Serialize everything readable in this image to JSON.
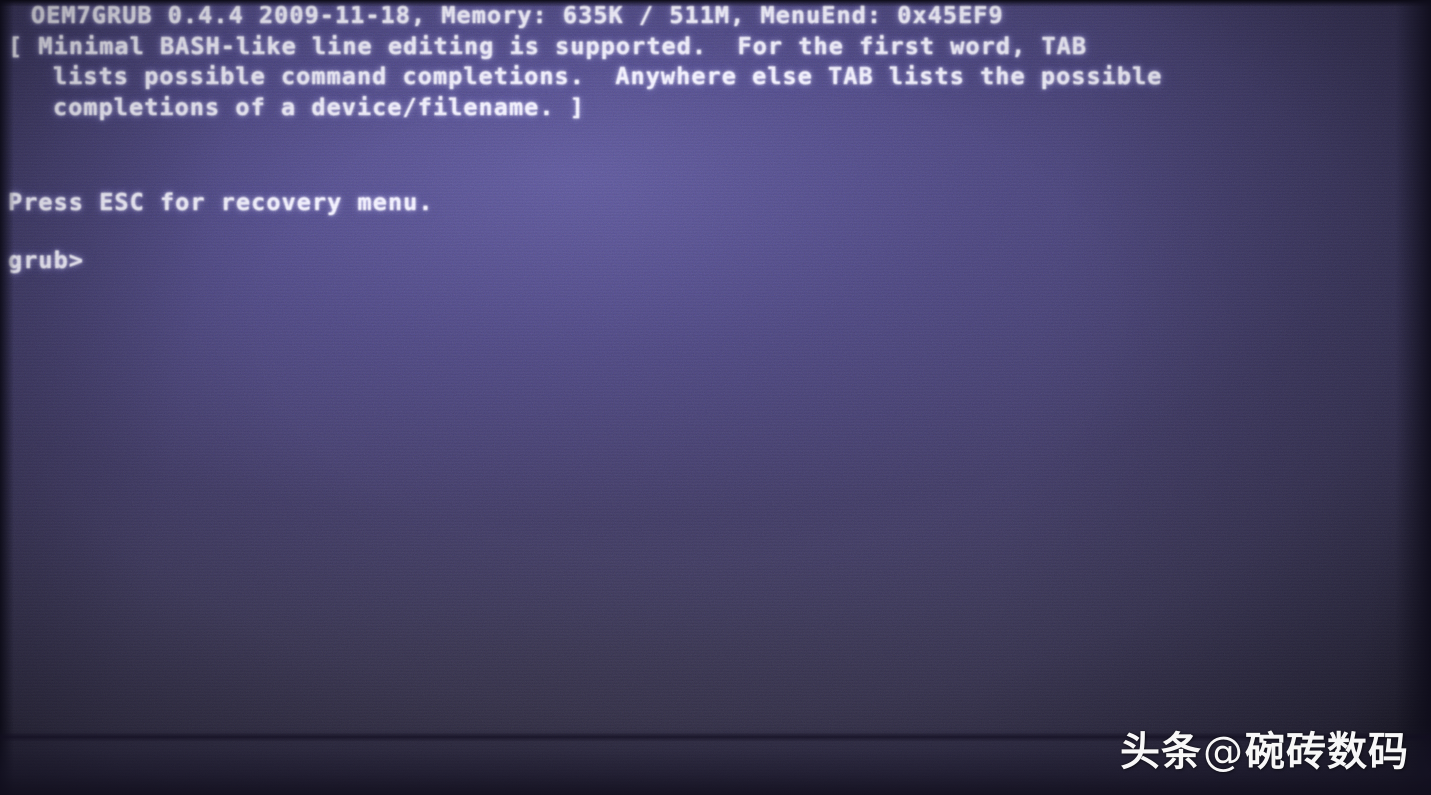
{
  "screen": {
    "kind": "grub-bootloader-console",
    "background_color": "#3a3462",
    "text_color": "#f2f0ff",
    "lines": [
      {
        "id": "version-line",
        "text": "OEM7GRUB 0.4.4 2009-11-18, Memory: 635K / 511M, MenuEnd: 0x45EF9"
      },
      {
        "id": "help-line-1",
        "text": "[ Minimal BASH-like line editing is supported.  For the first word, TAB"
      },
      {
        "id": "help-line-2",
        "text": "lists possible command completions.  Anywhere else TAB lists the possible"
      },
      {
        "id": "help-line-3",
        "text": "completions of a device/filename. ]"
      },
      {
        "id": "recovery-hint",
        "text": "Press ESC for recovery menu."
      },
      {
        "id": "prompt",
        "text": "grub>"
      }
    ],
    "details": {
      "bootloader_name": "OEM7GRUB",
      "version": "0.4.4",
      "build_date": "2009-11-18",
      "memory_low": "635K",
      "memory_high": "511M",
      "menu_end": "0x45EF9",
      "prompt_symbol": "grub>",
      "recovery_key": "ESC"
    }
  },
  "watermark": {
    "platform": "头条",
    "at": "@",
    "account": "碗砖数码"
  }
}
